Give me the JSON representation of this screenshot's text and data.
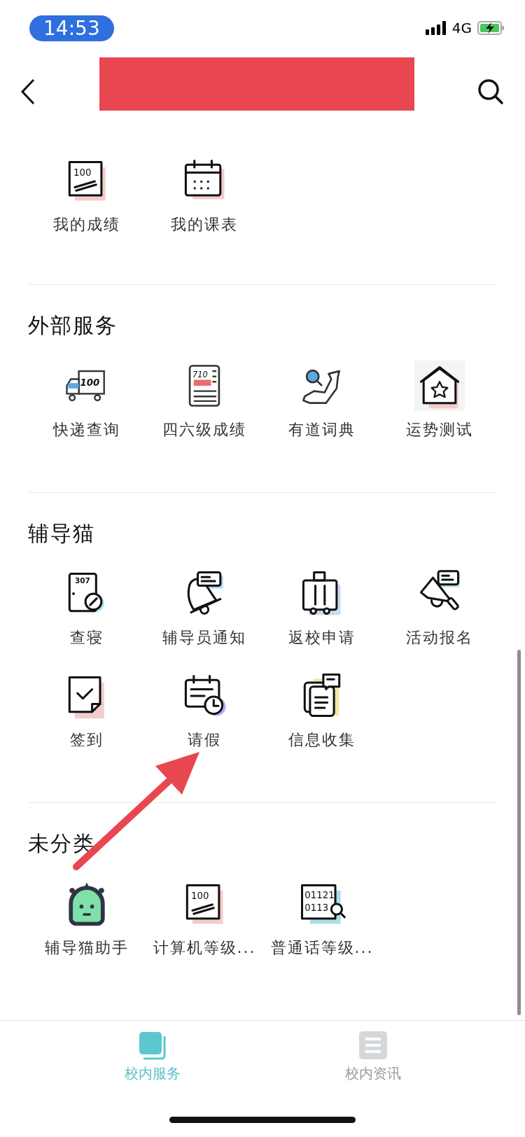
{
  "status_bar": {
    "time": "14:53",
    "network": "4G"
  },
  "sections": [
    {
      "items": [
        {
          "label": "我的成绩",
          "icon_text": [
            "100"
          ]
        },
        {
          "label": "我的课表"
        }
      ]
    },
    {
      "title": "外部服务",
      "items": [
        {
          "label": "快递查询",
          "icon_text": [
            "100"
          ]
        },
        {
          "label": "四六级成绩",
          "icon_text": [
            "710"
          ]
        },
        {
          "label": "有道词典"
        },
        {
          "label": "运势测试"
        }
      ]
    },
    {
      "title": "辅导猫",
      "items": [
        {
          "label": "查寝",
          "icon_text": [
            "307"
          ]
        },
        {
          "label": "辅导员通知"
        },
        {
          "label": "返校申请"
        },
        {
          "label": "活动报名"
        },
        {
          "label": "签到"
        },
        {
          "label": "请假"
        },
        {
          "label": "信息收集"
        }
      ]
    },
    {
      "title": "未分类",
      "items": [
        {
          "label": "辅导猫助手"
        },
        {
          "label": "计算机等级...",
          "icon_text": [
            "100"
          ]
        },
        {
          "label": "普通话等级...",
          "icon_text": [
            "01121",
            "0113"
          ]
        }
      ]
    }
  ],
  "tabs": [
    {
      "label": "校内服务",
      "selected": true
    },
    {
      "label": "校内资讯",
      "selected": false
    }
  ]
}
